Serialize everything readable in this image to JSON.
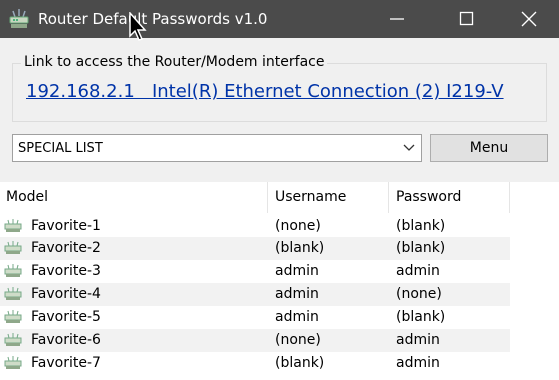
{
  "window": {
    "title": "Router Default Passwords v1.0",
    "controls": [
      "minimize-icon",
      "maximize-icon",
      "close-icon"
    ]
  },
  "link_group": {
    "legend": "Link to access the Router/Modem interface",
    "link_text": "192.168.2.1   Intel(R) Ethernet Connection (2) I219-V"
  },
  "toolbar": {
    "list_select_value": "SPECIAL LIST",
    "menu_label": "Menu"
  },
  "table": {
    "columns": [
      "Model",
      "Username",
      "Password"
    ],
    "rows": [
      {
        "model": "Favorite-1",
        "username": "(none)",
        "password": "(blank)"
      },
      {
        "model": "Favorite-2",
        "username": "(blank)",
        "password": "(blank)"
      },
      {
        "model": "Favorite-3",
        "username": "admin",
        "password": "admin"
      },
      {
        "model": "Favorite-4",
        "username": "admin",
        "password": "(none)"
      },
      {
        "model": "Favorite-5",
        "username": "admin",
        "password": "(blank)"
      },
      {
        "model": "Favorite-6",
        "username": "(none)",
        "password": "admin"
      },
      {
        "model": "Favorite-7",
        "username": "(blank)",
        "password": "admin"
      }
    ]
  },
  "colors": {
    "titlebar": "#4b4b4b",
    "link": "#0033a8",
    "alt_row": "#f2f2f2"
  }
}
